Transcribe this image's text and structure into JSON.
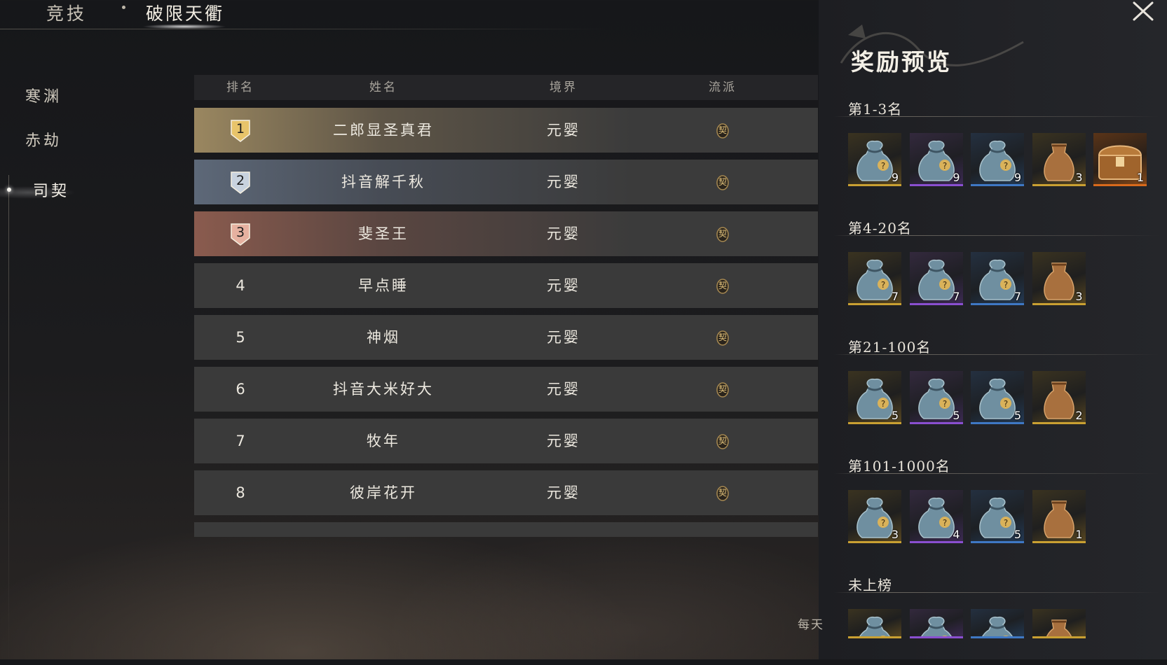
{
  "header": {
    "tab_arena": "竞技",
    "tab_current": "破限天衢"
  },
  "nav": {
    "items": [
      "寒渊",
      "赤劫",
      "司契"
    ],
    "active_index": 2
  },
  "table": {
    "headers": [
      "排名",
      "姓名",
      "境界",
      "流派"
    ],
    "rows": [
      {
        "rank": "1",
        "name": "二郎显圣真君",
        "realm": "元婴",
        "school": "契"
      },
      {
        "rank": "2",
        "name": "抖音解千秋",
        "realm": "元婴",
        "school": "契"
      },
      {
        "rank": "3",
        "name": "斐圣王",
        "realm": "元婴",
        "school": "契"
      },
      {
        "rank": "4",
        "name": "早点睡",
        "realm": "元婴",
        "school": "契"
      },
      {
        "rank": "5",
        "name": "神烟",
        "realm": "元婴",
        "school": "契"
      },
      {
        "rank": "6",
        "name": "抖音大米好大",
        "realm": "元婴",
        "school": "契"
      },
      {
        "rank": "7",
        "name": "牧年",
        "realm": "元婴",
        "school": "契"
      },
      {
        "rank": "8",
        "name": "彼岸花开",
        "realm": "元婴",
        "school": "契"
      }
    ]
  },
  "panel": {
    "title": "奖励预览",
    "tiers": [
      {
        "label": "第1-3名",
        "items": [
          {
            "icon": "pouch-icon",
            "quality": "gold",
            "count": "9"
          },
          {
            "icon": "pouch-icon",
            "quality": "purple",
            "count": "9"
          },
          {
            "icon": "pouch-icon",
            "quality": "blue",
            "count": "9"
          },
          {
            "icon": "coin-bag-icon",
            "quality": "gold",
            "count": "3"
          },
          {
            "icon": "treasure-chest-icon",
            "quality": "orange",
            "count": "1"
          }
        ]
      },
      {
        "label": "第4-20名",
        "items": [
          {
            "icon": "pouch-icon",
            "quality": "gold",
            "count": "7"
          },
          {
            "icon": "pouch-icon",
            "quality": "purple",
            "count": "7"
          },
          {
            "icon": "pouch-icon",
            "quality": "blue",
            "count": "7"
          },
          {
            "icon": "coin-bag-icon",
            "quality": "gold",
            "count": "3"
          }
        ]
      },
      {
        "label": "第21-100名",
        "items": [
          {
            "icon": "pouch-icon",
            "quality": "gold",
            "count": "5"
          },
          {
            "icon": "pouch-icon",
            "quality": "purple",
            "count": "5"
          },
          {
            "icon": "pouch-icon",
            "quality": "blue",
            "count": "5"
          },
          {
            "icon": "coin-bag-icon",
            "quality": "gold",
            "count": "2"
          }
        ]
      },
      {
        "label": "第101-1000名",
        "items": [
          {
            "icon": "pouch-icon",
            "quality": "gold",
            "count": "3"
          },
          {
            "icon": "pouch-icon",
            "quality": "purple",
            "count": "4"
          },
          {
            "icon": "pouch-icon",
            "quality": "blue",
            "count": "5"
          },
          {
            "icon": "coin-bag-icon",
            "quality": "gold",
            "count": "1"
          }
        ]
      },
      {
        "label": "未上榜",
        "items": [
          {
            "icon": "pouch-icon",
            "quality": "gold",
            "count": ""
          },
          {
            "icon": "pouch-icon",
            "quality": "purple",
            "count": ""
          },
          {
            "icon": "pouch-icon",
            "quality": "blue",
            "count": ""
          },
          {
            "icon": "coin-bag-icon",
            "quality": "gold",
            "count": ""
          }
        ]
      }
    ]
  },
  "footer": {
    "daily_text": "每天"
  },
  "colors": {
    "quality_gold": "#c9a032",
    "quality_purple": "#8a4fd0",
    "quality_blue": "#3f78c4",
    "quality_orange": "#d86a1c",
    "rank1_row": "#9a8760",
    "rank2_row": "#5d6878",
    "rank3_row": "#8a5b4e"
  }
}
